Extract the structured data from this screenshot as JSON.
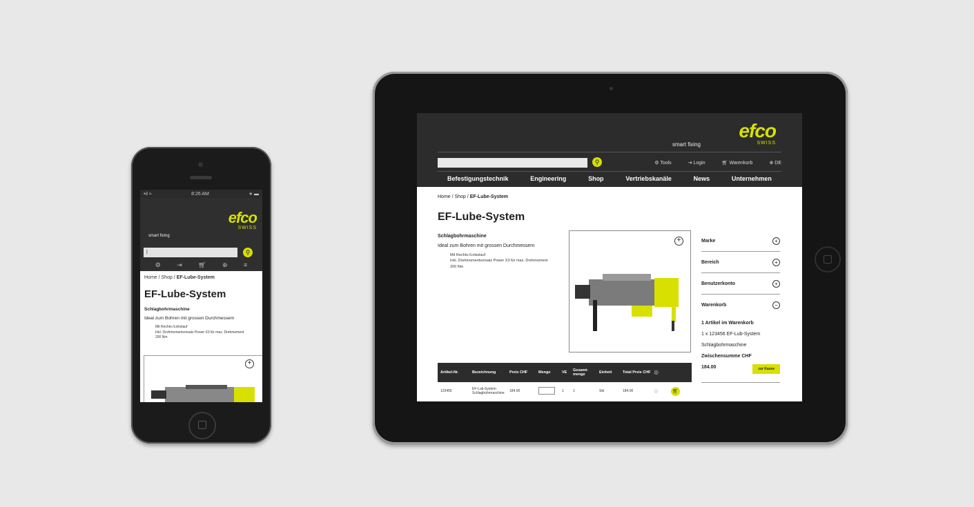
{
  "brand": {
    "logo": "efco",
    "logo_sub": "SWISS",
    "tagline": "smart fixing",
    "accent": "#d7e000",
    "header_bg": "#2c2c2c"
  },
  "phone": {
    "status": {
      "left": "•ıl ≈",
      "time": "8:26 AM",
      "right": "∗ ▬"
    },
    "search_value": "|",
    "breadcrumb": {
      "prefix": "Home / Shop / ",
      "current": "EF-Lube-System"
    },
    "title": "EF-Lube-System",
    "subtitle": "Schlagbohrmaschine",
    "description": "Ideal zum Bohren mit grossen Durchmessern",
    "bullets": [
      "Mit Rechts-/Linkslauf",
      "Inkl. Drehmomentvorsatz Power X3 für max. Drehmoment",
      "200 Nm"
    ]
  },
  "tablet": {
    "links": [
      "Tools",
      "Login",
      "Warenkorb",
      "DE"
    ],
    "nav": [
      "Befestigungstechnik",
      "Engineering",
      "Shop",
      "Vertriebskanäle",
      "News",
      "Unternehmen"
    ],
    "breadcrumb": {
      "prefix": "Home / Shop / ",
      "current": "EF-Lube-System"
    },
    "title": "EF-Lube-System",
    "subtitle": "Schlagbohrmaschine",
    "description": "Ideal zum Bohren mit grossen Durchmessern",
    "bullets": [
      "Mit Rechts-/Linkslauf",
      "Inkl. Drehmomentvorsatz Power X3 für max. Drehmoment",
      "200 Nm"
    ],
    "sidebar": {
      "sections": [
        "Marke",
        "Bereich",
        "Benutzerkonto",
        "Warenkorb"
      ],
      "cart_count": "1 Artikel im Warenkorb",
      "cart_item": "1 x 123456 EF-Lub-System",
      "cart_item_desc": "Schlagbohrmaschine",
      "subtotal_label": "Zwischensumme CHF",
      "subtotal": "184.00",
      "checkout": "zur Kasse"
    },
    "table": {
      "headers": [
        "Artikel-Nr.",
        "Bezeichnung",
        "Preis CHF",
        "Menge",
        "VE",
        "Gesamt-menge",
        "Einheit",
        "Total Preis CHF",
        "ⓘ"
      ],
      "row": [
        "123456",
        "EF-Lub-System Schlagbohrmaschine",
        "184.00",
        "",
        "1",
        "1",
        "Stk",
        "184.00",
        "ⓘ"
      ]
    }
  }
}
